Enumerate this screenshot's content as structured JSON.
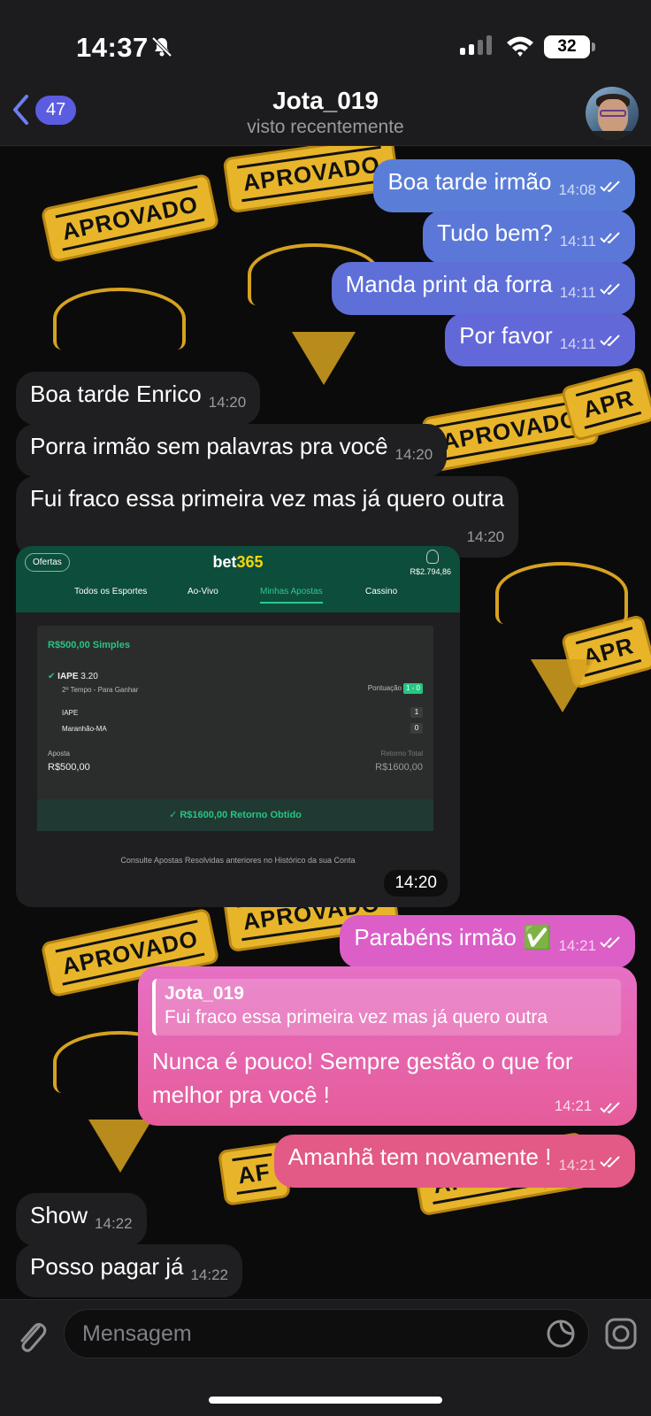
{
  "status_bar": {
    "time": "14:37",
    "battery": "32"
  },
  "header": {
    "back_count": "47",
    "title": "Jota_019",
    "subtitle": "visto recentemente"
  },
  "messages": [
    {
      "dir": "out",
      "text": "Boa tarde irmão",
      "time": "14:08"
    },
    {
      "dir": "out",
      "text": "Tudo bem?",
      "time": "14:11"
    },
    {
      "dir": "out",
      "text": "Manda print da forra",
      "time": "14:11"
    },
    {
      "dir": "out",
      "text": "Por favor",
      "time": "14:11"
    },
    {
      "dir": "in",
      "text": "Boa tarde Enrico",
      "time": "14:20"
    },
    {
      "dir": "in",
      "text": "Porra irmão sem palavras pra você",
      "time": "14:20"
    },
    {
      "dir": "in",
      "text": "Fui fraco essa primeira vez mas já quero outra",
      "time": "14:20"
    },
    {
      "dir": "out",
      "text": "Parabéns irmão ✅",
      "time": "14:21"
    },
    {
      "dir": "out",
      "text": "Amanhã tem novamente !",
      "time": "14:21"
    },
    {
      "dir": "in",
      "text": "Show",
      "time": "14:22"
    },
    {
      "dir": "in",
      "text": "Posso pagar já",
      "time": "14:22"
    }
  ],
  "image_message": {
    "time": "14:20",
    "ofertas": "Ofertas",
    "logo_a": "bet",
    "logo_b": "365",
    "balance": "R$2.794,86",
    "tabs": [
      "Todos os Esportes",
      "Ao-Vivo",
      "Minhas Apostas",
      "Cassino"
    ],
    "bet_title": "R$500,00 Simples",
    "selection": "IAPE",
    "odds": "3.20",
    "market": "2º Tempo - Para Ganhar",
    "score_label": "Pontuação",
    "score": "1 - 0",
    "team1": "IAPE",
    "team1_score": "1",
    "team2": "Maranhão-MA",
    "team2_score": "0",
    "stake_label": "Aposta",
    "stake": "R$500,00",
    "return_label": "Retorno Total",
    "return_value": "R$1600,00",
    "return_obtained": "R$1600,00  Retorno Obtido",
    "footer_note": "Consulte Apostas Resolvidas anteriores no Histórico da sua Conta"
  },
  "reply_message": {
    "quoted_name": "Jota_019",
    "quoted_text": "Fui fraco essa primeira vez mas já quero outra",
    "text": "Nunca é pouco! Sempre gestão o que for melhor pra você !",
    "time": "14:21"
  },
  "wallpaper": {
    "stamp_text": "APROVADO"
  },
  "input": {
    "placeholder": "Mensagem"
  },
  "colors": {
    "accent": "#5b5ce0",
    "bubble_gradient_top": "#5f7fd6",
    "bubble_gradient_pink": "#e65c9a",
    "wallpaper_gold": "#e8b52a",
    "incoming": "#1f1f21"
  },
  "icons": [
    "bell-slash-icon",
    "signal-icon",
    "wifi-icon",
    "chevron-left-icon",
    "double-check-icon",
    "paperclip-icon",
    "sticker-icon",
    "camera-icon"
  ]
}
